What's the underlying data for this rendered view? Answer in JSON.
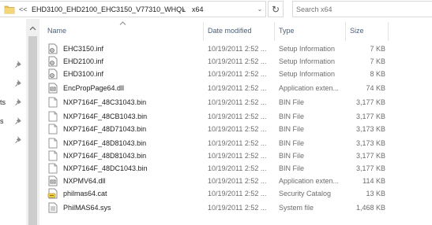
{
  "address_bar": {
    "overflow_label": "<<",
    "separator": "›",
    "crumbs": [
      "EHD3100_EHD2100_EHC3150_V77310_WHQL",
      "x64"
    ],
    "dropdown_glyph": "⌄",
    "refresh_glyph": "↻"
  },
  "search": {
    "placeholder": "Search x64",
    "value": ""
  },
  "nav_fragments": [
    "ts",
    "s"
  ],
  "columns": {
    "name": "Name",
    "date": "Date modified",
    "type": "Type",
    "size": "Size"
  },
  "files": [
    {
      "name": "EHC3150.inf",
      "date": "10/19/2011 2:52 ...",
      "type": "Setup Information",
      "size": "7 KB",
      "icon": "setup-info-icon"
    },
    {
      "name": "EHD2100.inf",
      "date": "10/19/2011 2:52 ...",
      "type": "Setup Information",
      "size": "7 KB",
      "icon": "setup-info-icon"
    },
    {
      "name": "EHD3100.inf",
      "date": "10/19/2011 2:52 ...",
      "type": "Setup Information",
      "size": "8 KB",
      "icon": "setup-info-icon"
    },
    {
      "name": "EncPropPage64.dll",
      "date": "10/19/2011 2:52 ...",
      "type": "Application exten...",
      "size": "74 KB",
      "icon": "dll-icon"
    },
    {
      "name": "NXP7164F_48C31043.bin",
      "date": "10/19/2011 2:52 ...",
      "type": "BIN File",
      "size": "3,177 KB",
      "icon": "bin-file-icon"
    },
    {
      "name": "NXP7164F_48CB1043.bin",
      "date": "10/19/2011 2:52 ...",
      "type": "BIN File",
      "size": "3,177 KB",
      "icon": "bin-file-icon"
    },
    {
      "name": "NXP7164F_48D71043.bin",
      "date": "10/19/2011 2:52 ...",
      "type": "BIN File",
      "size": "3,173 KB",
      "icon": "bin-file-icon"
    },
    {
      "name": "NXP7164F_48D81043.bin",
      "date": "10/19/2011 2:52 ...",
      "type": "BIN File",
      "size": "3,173 KB",
      "icon": "bin-file-icon"
    },
    {
      "name": "NXP7164F_48D81043.bin",
      "date": "10/19/2011 2:52 ...",
      "type": "BIN File",
      "size": "3,177 KB",
      "icon": "bin-file-icon"
    },
    {
      "name": "NXP7164F_48DC1043.bin",
      "date": "10/19/2011 2:52 ...",
      "type": "BIN File",
      "size": "3,177 KB",
      "icon": "bin-file-icon"
    },
    {
      "name": "NXPMV64.dll",
      "date": "10/19/2011 2:52 ...",
      "type": "Application exten...",
      "size": "114 KB",
      "icon": "dll-icon"
    },
    {
      "name": "philmas64.cat",
      "date": "10/19/2011 2:52 ...",
      "type": "Security Catalog",
      "size": "13 KB",
      "icon": "security-catalog-icon"
    },
    {
      "name": "PhilMAS64.sys",
      "date": "10/19/2011 2:52 ...",
      "type": "System file",
      "size": "1,468 KB",
      "icon": "system-file-icon"
    }
  ],
  "colors": {
    "header_text": "#4c607a",
    "secondary_text": "#6d6d6d",
    "folder": "#e8c15a",
    "border": "#d9d9d9"
  }
}
